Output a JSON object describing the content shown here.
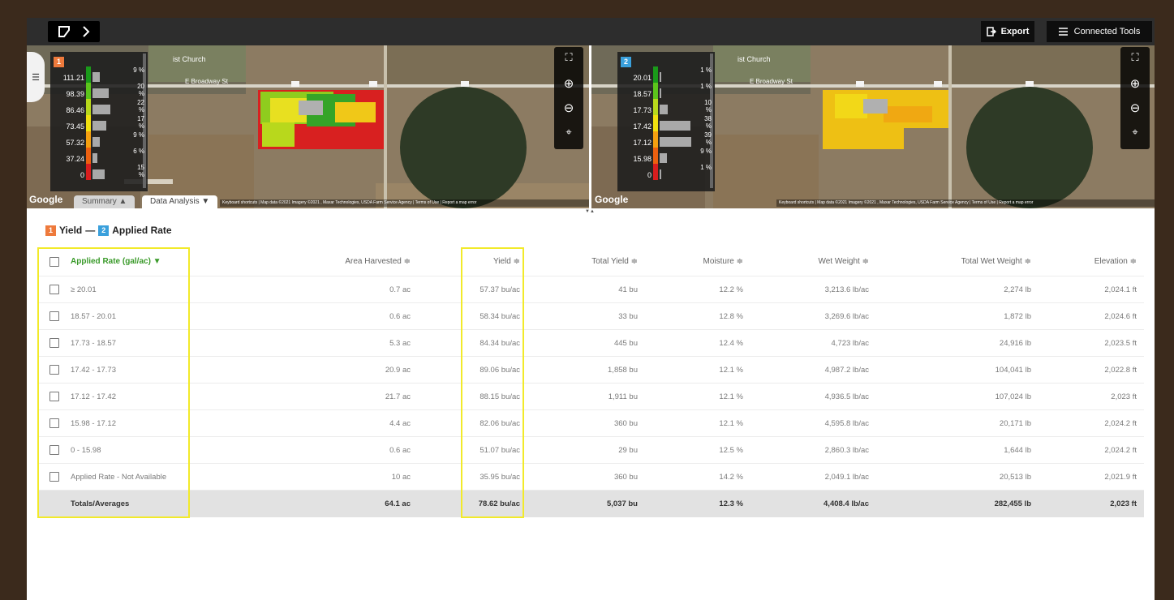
{
  "toolbar": {
    "export_label": "Export",
    "connected_tools_label": "Connected Tools"
  },
  "maps": [
    {
      "layer_badge": "1",
      "layer_color": "#ee7a3c",
      "legend": [
        {
          "value": "111.21",
          "pct": "9 %",
          "color": "#1a9a1a",
          "fraction": 0.09
        },
        {
          "value": "98.39",
          "pct": "20 %",
          "color": "#5cc41c",
          "fraction": 0.2
        },
        {
          "value": "86.46",
          "pct": "22 %",
          "color": "#b8d81c",
          "fraction": 0.22
        },
        {
          "value": "73.45",
          "pct": "17 %",
          "color": "#f0e010",
          "fraction": 0.17
        },
        {
          "value": "57.32",
          "pct": "9 %",
          "color": "#f5a010",
          "fraction": 0.09
        },
        {
          "value": "37.24",
          "pct": "6 %",
          "color": "#ec6010",
          "fraction": 0.06
        },
        {
          "value": "0",
          "pct": "15 %",
          "color": "#d81e1e",
          "fraction": 0.15
        }
      ],
      "road_label": "E Broadway St",
      "place_label": "ist Church",
      "google_label": "Google",
      "tabs": [
        "Summary ▲",
        "Data Analysis ▼"
      ],
      "attribution": "Keyboard shortcuts | Map data ©2021 Imagery ©2021 , Maxar Technologies, USDA Farm Service Agency | Terms of Use | Report a map error"
    },
    {
      "layer_badge": "2",
      "layer_color": "#3aa0dc",
      "legend": [
        {
          "value": "20.01",
          "pct": "1 %",
          "color": "#1a9a1a",
          "fraction": 0.01
        },
        {
          "value": "18.57",
          "pct": "1 %",
          "color": "#5cc41c",
          "fraction": 0.01
        },
        {
          "value": "17.73",
          "pct": "10 %",
          "color": "#b8d81c",
          "fraction": 0.1
        },
        {
          "value": "17.42",
          "pct": "38 %",
          "color": "#f0e010",
          "fraction": 0.38
        },
        {
          "value": "17.12",
          "pct": "39 %",
          "color": "#f5a010",
          "fraction": 0.39
        },
        {
          "value": "15.98",
          "pct": "9 %",
          "color": "#ec6010",
          "fraction": 0.09
        },
        {
          "value": "0",
          "pct": "1 %",
          "color": "#d81e1e",
          "fraction": 0.01
        }
      ],
      "road_label": "E Broadway St",
      "place_label": "ist Church",
      "google_label": "Google",
      "attribution": "Keyboard shortcuts | Map data ©2021 Imagery ©2021 , Maxar Technologies, USDA Farm Service Agency | Terms of Use | Report a map error"
    }
  ],
  "compare": {
    "badge1": "1",
    "label1": "Yield",
    "separator": "—",
    "badge2": "2",
    "label2": "Applied Rate"
  },
  "table": {
    "headers": [
      "Applied Rate (gal/ac) ▼",
      "Area Harvested ≑",
      "Yield ≑",
      "Total Yield ≑",
      "Moisture ≑",
      "Wet Weight ≑",
      "Total Wet Weight ≑",
      "Elevation ≑"
    ],
    "rows": [
      [
        "≥ 20.01",
        "0.7 ac",
        "57.37 bu/ac",
        "41 bu",
        "12.2 %",
        "3,213.6 lb/ac",
        "2,274 lb",
        "2,024.1 ft"
      ],
      [
        "18.57 - 20.01",
        "0.6 ac",
        "58.34 bu/ac",
        "33 bu",
        "12.8 %",
        "3,269.6 lb/ac",
        "1,872 lb",
        "2,024.6 ft"
      ],
      [
        "17.73 - 18.57",
        "5.3 ac",
        "84.34 bu/ac",
        "445 bu",
        "12.4 %",
        "4,723 lb/ac",
        "24,916 lb",
        "2,023.5 ft"
      ],
      [
        "17.42 - 17.73",
        "20.9 ac",
        "89.06 bu/ac",
        "1,858 bu",
        "12.1 %",
        "4,987.2 lb/ac",
        "104,041 lb",
        "2,022.8 ft"
      ],
      [
        "17.12 - 17.42",
        "21.7 ac",
        "88.15 bu/ac",
        "1,911 bu",
        "12.1 %",
        "4,936.5 lb/ac",
        "107,024 lb",
        "2,023 ft"
      ],
      [
        "15.98 - 17.12",
        "4.4 ac",
        "82.06 bu/ac",
        "360 bu",
        "12.1 %",
        "4,595.8 lb/ac",
        "20,171 lb",
        "2,024.2 ft"
      ],
      [
        "0 - 15.98",
        "0.6 ac",
        "51.07 bu/ac",
        "29 bu",
        "12.5 %",
        "2,860.3 lb/ac",
        "1,644 lb",
        "2,024.2 ft"
      ],
      [
        "Applied Rate - Not Available",
        "10 ac",
        "35.95 bu/ac",
        "360 bu",
        "14.2 %",
        "2,049.1 lb/ac",
        "20,513 lb",
        "2,021.9 ft"
      ]
    ],
    "totals": [
      "Totals/Averages",
      "64.1 ac",
      "78.62 bu/ac",
      "5,037 bu",
      "12.3 %",
      "4,408.4 lb/ac",
      "282,455 lb",
      "2,023 ft"
    ]
  },
  "colors": {
    "accent_green": "#3a9a2a",
    "highlight_box": "#f2ea2a",
    "totals_bg": "#e2e2e2"
  }
}
